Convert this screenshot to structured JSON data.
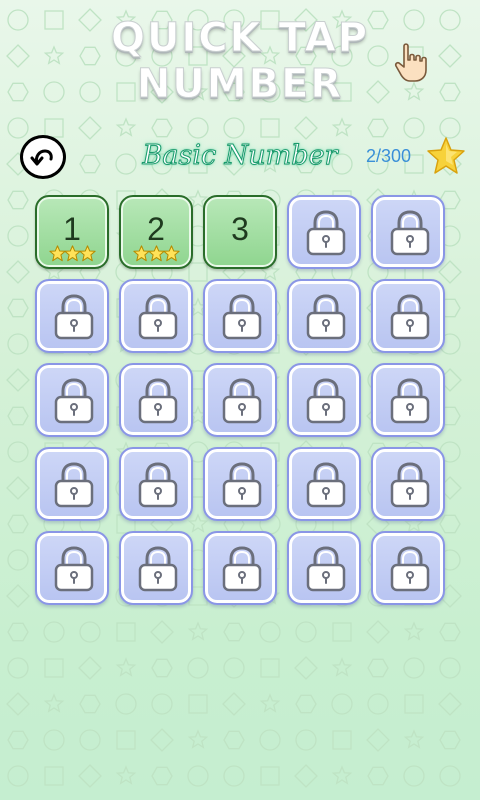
{
  "header": {
    "title_line1": "QUICK TAP",
    "title_line2": "NUMBER",
    "hand_icon": "pointing-hand-icon"
  },
  "toolbar": {
    "back_icon": "back-arrow-icon",
    "level_title": "Basic Number",
    "star_count": "2/300",
    "star_icon": "gold-star-icon"
  },
  "colors": {
    "unlocked_tile": "#9ad99a",
    "locked_tile": "#c3cef4",
    "star_gold": "#f7d23a",
    "counter_blue": "#3a8fd8"
  },
  "levels": [
    {
      "label": "1",
      "state": "unlocked",
      "stars": 3
    },
    {
      "label": "2",
      "state": "unlocked",
      "stars": 3
    },
    {
      "label": "3",
      "state": "unlocked",
      "stars": 0
    },
    {
      "label": "",
      "state": "locked",
      "stars": 0
    },
    {
      "label": "",
      "state": "locked",
      "stars": 0
    },
    {
      "label": "",
      "state": "locked",
      "stars": 0
    },
    {
      "label": "",
      "state": "locked",
      "stars": 0
    },
    {
      "label": "",
      "state": "locked",
      "stars": 0
    },
    {
      "label": "",
      "state": "locked",
      "stars": 0
    },
    {
      "label": "",
      "state": "locked",
      "stars": 0
    },
    {
      "label": "",
      "state": "locked",
      "stars": 0
    },
    {
      "label": "",
      "state": "locked",
      "stars": 0
    },
    {
      "label": "",
      "state": "locked",
      "stars": 0
    },
    {
      "label": "",
      "state": "locked",
      "stars": 0
    },
    {
      "label": "",
      "state": "locked",
      "stars": 0
    },
    {
      "label": "",
      "state": "locked",
      "stars": 0
    },
    {
      "label": "",
      "state": "locked",
      "stars": 0
    },
    {
      "label": "",
      "state": "locked",
      "stars": 0
    },
    {
      "label": "",
      "state": "locked",
      "stars": 0
    },
    {
      "label": "",
      "state": "locked",
      "stars": 0
    },
    {
      "label": "",
      "state": "locked",
      "stars": 0
    },
    {
      "label": "",
      "state": "locked",
      "stars": 0
    },
    {
      "label": "",
      "state": "locked",
      "stars": 0
    },
    {
      "label": "",
      "state": "locked",
      "stars": 0
    },
    {
      "label": "",
      "state": "locked",
      "stars": 0
    }
  ]
}
